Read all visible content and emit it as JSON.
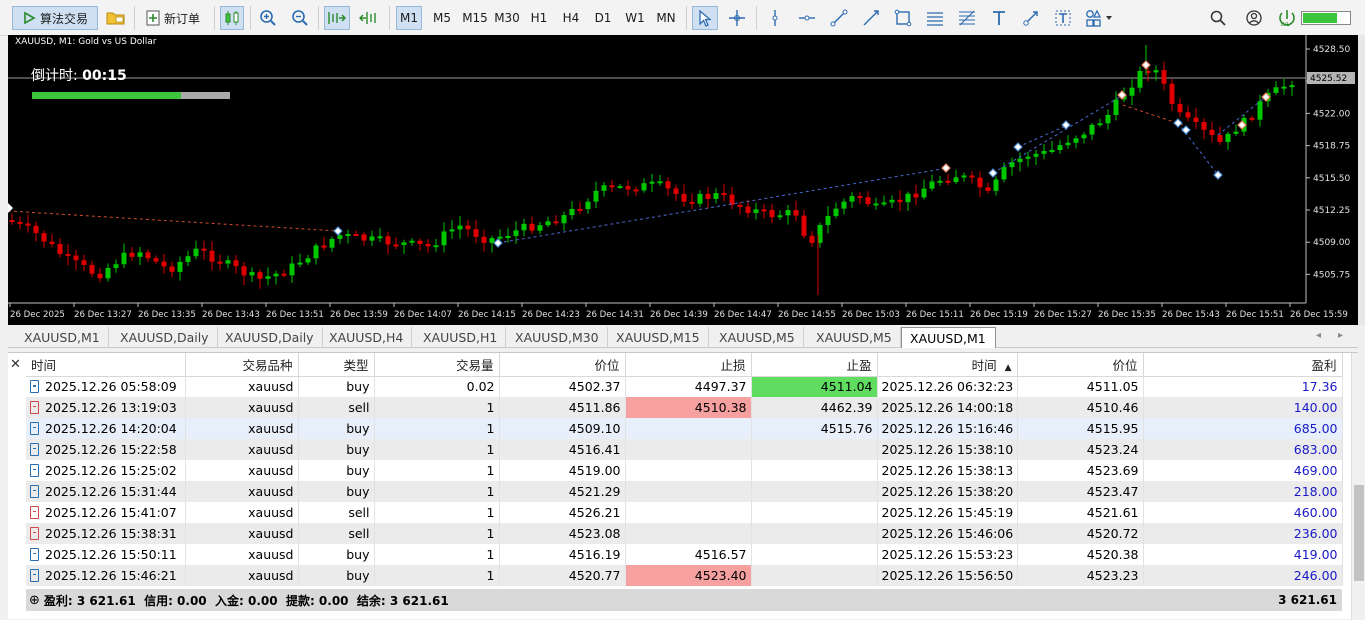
{
  "toolbar": {
    "algo_trading": "算法交易",
    "new_order": "新订单",
    "timeframes": [
      "M1",
      "M5",
      "M15",
      "M30",
      "H1",
      "H4",
      "D1",
      "W1",
      "MN"
    ],
    "active_timeframe": "M1"
  },
  "chart": {
    "title": "XAUUSD, M1:  Gold vs US Dollar",
    "countdown_label": "倒计时: ",
    "countdown_value": "00:15",
    "countdown_progress": 0.75,
    "current_price": "4525.52",
    "price_ticks": [
      "4528.50",
      "4525.25",
      "4522.00",
      "4518.75",
      "4515.50",
      "4512.25",
      "4509.00",
      "4505.75"
    ],
    "time_ticks": [
      "26 Dec 2025",
      "26 Dec 13:27",
      "26 Dec 13:35",
      "26 Dec 13:43",
      "26 Dec 13:51",
      "26 Dec 13:59",
      "26 Dec 14:07",
      "26 Dec 14:15",
      "26 Dec 14:23",
      "26 Dec 14:31",
      "26 Dec 14:39",
      "26 Dec 14:47",
      "26 Dec 14:55",
      "26 Dec 15:03",
      "26 Dec 15:11",
      "26 Dec 15:19",
      "26 Dec 15:27",
      "26 Dec 15:35",
      "26 Dec 15:43",
      "26 Dec 15:51",
      "26 Dec 15:59"
    ],
    "colors": {
      "bull": "#00c800",
      "bear": "#e00000",
      "background": "#000000"
    }
  },
  "tabs": [
    "XAUUSD,M1",
    "XAUUSD,Daily",
    "XAUUSD,Daily",
    "XAUUSD,H4",
    "XAUUSD,H1",
    "XAUUSD,M30",
    "XAUUSD,M15",
    "XAUUSD,M5",
    "XAUUSD,M5",
    "XAUUSD,M1"
  ],
  "history": {
    "columns": [
      "时间",
      "交易品种",
      "类型",
      "交易量",
      "价位",
      "止损",
      "止盈",
      "时间",
      "价位",
      "盈利"
    ],
    "sort_indicator": "▲",
    "rows": [
      {
        "open_time": "2025.12.26 05:58:09",
        "symbol": "xauusd",
        "type": "buy",
        "volume": "0.02",
        "open_price": "4502.37",
        "sl": "4497.37",
        "tp": "4511.04",
        "close_time": "2025.12.26 06:32:23",
        "close_price": "4511.05",
        "profit": "17.36"
      },
      {
        "open_time": "2025.12.26 13:19:03",
        "symbol": "xauusd",
        "type": "sell",
        "volume": "1",
        "open_price": "4511.86",
        "sl": "4510.38",
        "tp": "4462.39",
        "close_time": "2025.12.26 14:00:18",
        "close_price": "4510.46",
        "profit": "140.00"
      },
      {
        "open_time": "2025.12.26 14:20:04",
        "symbol": "xauusd",
        "type": "buy",
        "volume": "1",
        "open_price": "4509.10",
        "sl": "",
        "tp": "4515.76",
        "close_time": "2025.12.26 15:16:46",
        "close_price": "4515.95",
        "profit": "685.00"
      },
      {
        "open_time": "2025.12.26 15:22:58",
        "symbol": "xauusd",
        "type": "buy",
        "volume": "1",
        "open_price": "4516.41",
        "sl": "",
        "tp": "",
        "close_time": "2025.12.26 15:38:10",
        "close_price": "4523.24",
        "profit": "683.00"
      },
      {
        "open_time": "2025.12.26 15:25:02",
        "symbol": "xauusd",
        "type": "buy",
        "volume": "1",
        "open_price": "4519.00",
        "sl": "",
        "tp": "",
        "close_time": "2025.12.26 15:38:13",
        "close_price": "4523.69",
        "profit": "469.00"
      },
      {
        "open_time": "2025.12.26 15:31:44",
        "symbol": "xauusd",
        "type": "buy",
        "volume": "1",
        "open_price": "4521.29",
        "sl": "",
        "tp": "",
        "close_time": "2025.12.26 15:38:20",
        "close_price": "4523.47",
        "profit": "218.00"
      },
      {
        "open_time": "2025.12.26 15:41:07",
        "symbol": "xauusd",
        "type": "sell",
        "volume": "1",
        "open_price": "4526.21",
        "sl": "",
        "tp": "",
        "close_time": "2025.12.26 15:45:19",
        "close_price": "4521.61",
        "profit": "460.00"
      },
      {
        "open_time": "2025.12.26 15:38:31",
        "symbol": "xauusd",
        "type": "sell",
        "volume": "1",
        "open_price": "4523.08",
        "sl": "",
        "tp": "",
        "close_time": "2025.12.26 15:46:06",
        "close_price": "4520.72",
        "profit": "236.00"
      },
      {
        "open_time": "2025.12.26 15:50:11",
        "symbol": "xauusd",
        "type": "buy",
        "volume": "1",
        "open_price": "4516.19",
        "sl": "4516.57",
        "tp": "",
        "close_time": "2025.12.26 15:53:23",
        "close_price": "4520.38",
        "profit": "419.00"
      },
      {
        "open_time": "2025.12.26 15:46:21",
        "symbol": "xauusd",
        "type": "buy",
        "volume": "1",
        "open_price": "4520.77",
        "sl": "4523.40",
        "tp": "",
        "close_time": "2025.12.26 15:56:50",
        "close_price": "4523.23",
        "profit": "246.00"
      }
    ],
    "summary": "盈利: 3 621.61  信用: 0.00  入金: 0.00  提款: 0.00  结余: 3 621.61",
    "total": "3 621.61"
  }
}
